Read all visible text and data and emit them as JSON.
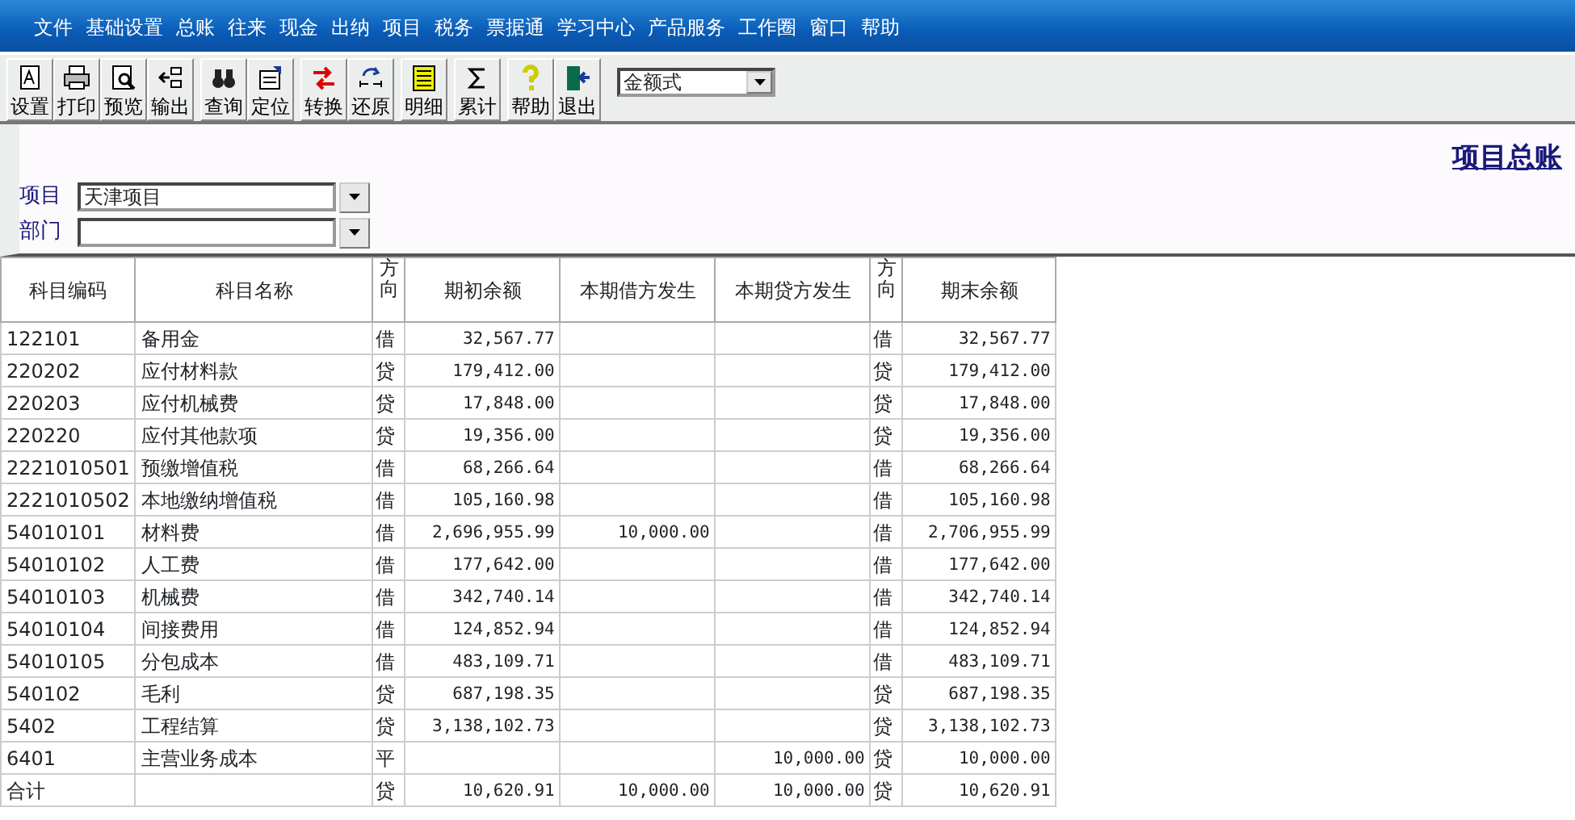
{
  "menu": [
    "文件",
    "基础设置",
    "总账",
    "往来",
    "现金",
    "出纳",
    "项目",
    "税务",
    "票据通",
    "学习中心",
    "产品服务",
    "工作圈",
    "窗口",
    "帮助"
  ],
  "toolbar": [
    [
      "设置",
      "打印",
      "预览",
      "输出"
    ],
    [
      "查询",
      "定位"
    ],
    [
      "转换",
      "还原"
    ],
    [
      "明细"
    ],
    [
      "累计"
    ],
    [
      "帮助",
      "退出"
    ]
  ],
  "format_select": {
    "value": "金额式"
  },
  "title": "项目总账",
  "filters": [
    {
      "label": "项目",
      "value": "天津项目"
    },
    {
      "label": "部门"
    }
  ],
  "table": {
    "columns": [
      "科目编码",
      "科目名称",
      "方向",
      "期初余额",
      "本期借方发生",
      "本期贷方发生",
      "方向",
      "期末余额"
    ],
    "rows": [
      [
        "122101",
        "备用金",
        "借",
        "32,567.77",
        "",
        "",
        "借",
        "32,567.77"
      ],
      [
        "220202",
        "应付材料款",
        "贷",
        "179,412.00",
        "",
        "",
        "贷",
        "179,412.00"
      ],
      [
        "220203",
        "应付机械费",
        "贷",
        "17,848.00",
        "",
        "",
        "贷",
        "17,848.00"
      ],
      [
        "220220",
        "应付其他款项",
        "贷",
        "19,356.00",
        "",
        "",
        "贷",
        "19,356.00"
      ],
      [
        "2221010501",
        "预缴增值税",
        "借",
        "68,266.64",
        "",
        "",
        "借",
        "68,266.64"
      ],
      [
        "2221010502",
        "本地缴纳增值税",
        "借",
        "105,160.98",
        "",
        "",
        "借",
        "105,160.98"
      ],
      [
        "54010101",
        "材料费",
        "借",
        "2,696,955.99",
        "10,000.00",
        "",
        "借",
        "2,706,955.99"
      ],
      [
        "54010102",
        "人工费",
        "借",
        "177,642.00",
        "",
        "",
        "借",
        "177,642.00"
      ],
      [
        "54010103",
        "机械费",
        "借",
        "342,740.14",
        "",
        "",
        "借",
        "342,740.14"
      ],
      [
        "54010104",
        "间接费用",
        "借",
        "124,852.94",
        "",
        "",
        "借",
        "124,852.94"
      ],
      [
        "54010105",
        "分包成本",
        "借",
        "483,109.71",
        "",
        "",
        "借",
        "483,109.71"
      ],
      [
        "540102",
        "毛利",
        "贷",
        "687,198.35",
        "",
        "",
        "贷",
        "687,198.35"
      ],
      [
        "5402",
        "工程结算",
        "贷",
        "3,138,102.73",
        "",
        "",
        "贷",
        "3,138,102.73"
      ],
      [
        "6401",
        "主营业务成本",
        "平",
        "",
        "",
        "10,000.00",
        "贷",
        "10,000.00"
      ],
      [
        "合计",
        "",
        "贷",
        "10,620.91",
        "10,000.00",
        "10,000.00",
        "贷",
        "10,620.91"
      ]
    ]
  }
}
